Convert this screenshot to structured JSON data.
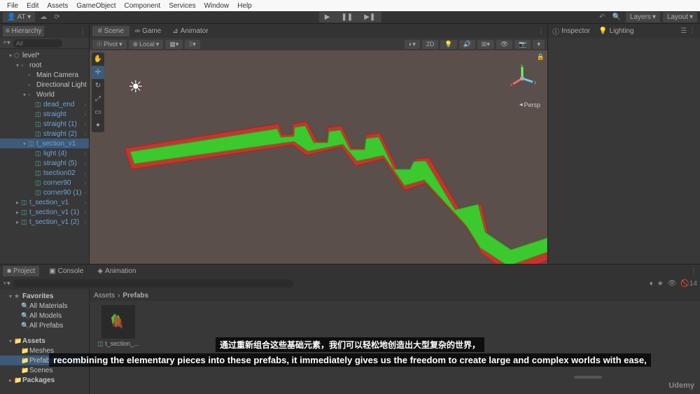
{
  "menu": {
    "items": [
      "File",
      "Edit",
      "Assets",
      "GameObject",
      "Component",
      "Services",
      "Window",
      "Help"
    ]
  },
  "toolbar": {
    "account": "AT ▾",
    "layers": "Layers",
    "layout": "Layout"
  },
  "hierarchy": {
    "tab": "Hierarchy",
    "search_placeholder": "All",
    "root": "level*",
    "items": [
      {
        "label": "root",
        "indent": 2,
        "type": "normal",
        "arrow": "▾"
      },
      {
        "label": "Main Camera",
        "indent": 3,
        "type": "normal"
      },
      {
        "label": "Directional Light",
        "indent": 3,
        "type": "normal"
      },
      {
        "label": "World",
        "indent": 3,
        "type": "normal",
        "arrow": "▾"
      },
      {
        "label": "dead_end",
        "indent": 4,
        "type": "prefab",
        "chevron": true
      },
      {
        "label": "straight",
        "indent": 4,
        "type": "prefab",
        "chevron": true
      },
      {
        "label": "straight (1)",
        "indent": 4,
        "type": "prefab",
        "chevron": true
      },
      {
        "label": "straight (2)",
        "indent": 4,
        "type": "prefab",
        "chevron": true
      },
      {
        "label": "t_section_v1",
        "indent": 3,
        "type": "prefab",
        "arrow": "▾",
        "selected": true,
        "chevron": true
      },
      {
        "label": "light (4)",
        "indent": 4,
        "type": "prefab",
        "chevron": true
      },
      {
        "label": "straight (5)",
        "indent": 4,
        "type": "prefab",
        "chevron": true
      },
      {
        "label": "tsection02",
        "indent": 4,
        "type": "prefab",
        "chevron": true
      },
      {
        "label": "corner90",
        "indent": 4,
        "type": "prefab",
        "chevron": true
      },
      {
        "label": "corner90 (1)",
        "indent": 4,
        "type": "prefab",
        "chevron": true
      },
      {
        "label": "t_section_v1",
        "indent": 2,
        "type": "prefab",
        "arrow": "▸",
        "chevron": true
      },
      {
        "label": "t_section_v1 (1)",
        "indent": 2,
        "type": "prefab",
        "arrow": "▸",
        "chevron": true
      },
      {
        "label": "t_section_v1 (2)",
        "indent": 2,
        "type": "prefab",
        "arrow": "▸",
        "chevron": true
      }
    ]
  },
  "scene": {
    "tabs": {
      "scene": "Scene",
      "game": "Game",
      "animator": "Animator"
    },
    "pivot": "Pivot",
    "local": "Local",
    "twod": "2D",
    "persp": "Persp"
  },
  "inspector": {
    "inspector": "Inspector",
    "lighting": "Lighting"
  },
  "project": {
    "tabs": {
      "project": "Project",
      "console": "Console",
      "animation": "Animation"
    },
    "count": "14",
    "breadcrumb": {
      "root": "Assets",
      "current": "Prefabs"
    },
    "search_placeholder": "",
    "tree": {
      "favorites": "Favorites",
      "fav_items": [
        "All Materials",
        "All Models",
        "All Prefabs"
      ],
      "assets": "Assets",
      "folders": [
        "Meshes",
        "Prefabs",
        "Scenes"
      ],
      "packages": "Packages"
    },
    "asset": {
      "name": "t_section_..."
    }
  },
  "subtitles": {
    "cn": "通过重新组合这些基础元素，我们可以轻松地创造出大型复杂的世界，",
    "en": "recombining the elementary pieces into these prefabs, it immediately gives us the freedom to create large and complex worlds with ease,"
  },
  "branding": "Udemy"
}
